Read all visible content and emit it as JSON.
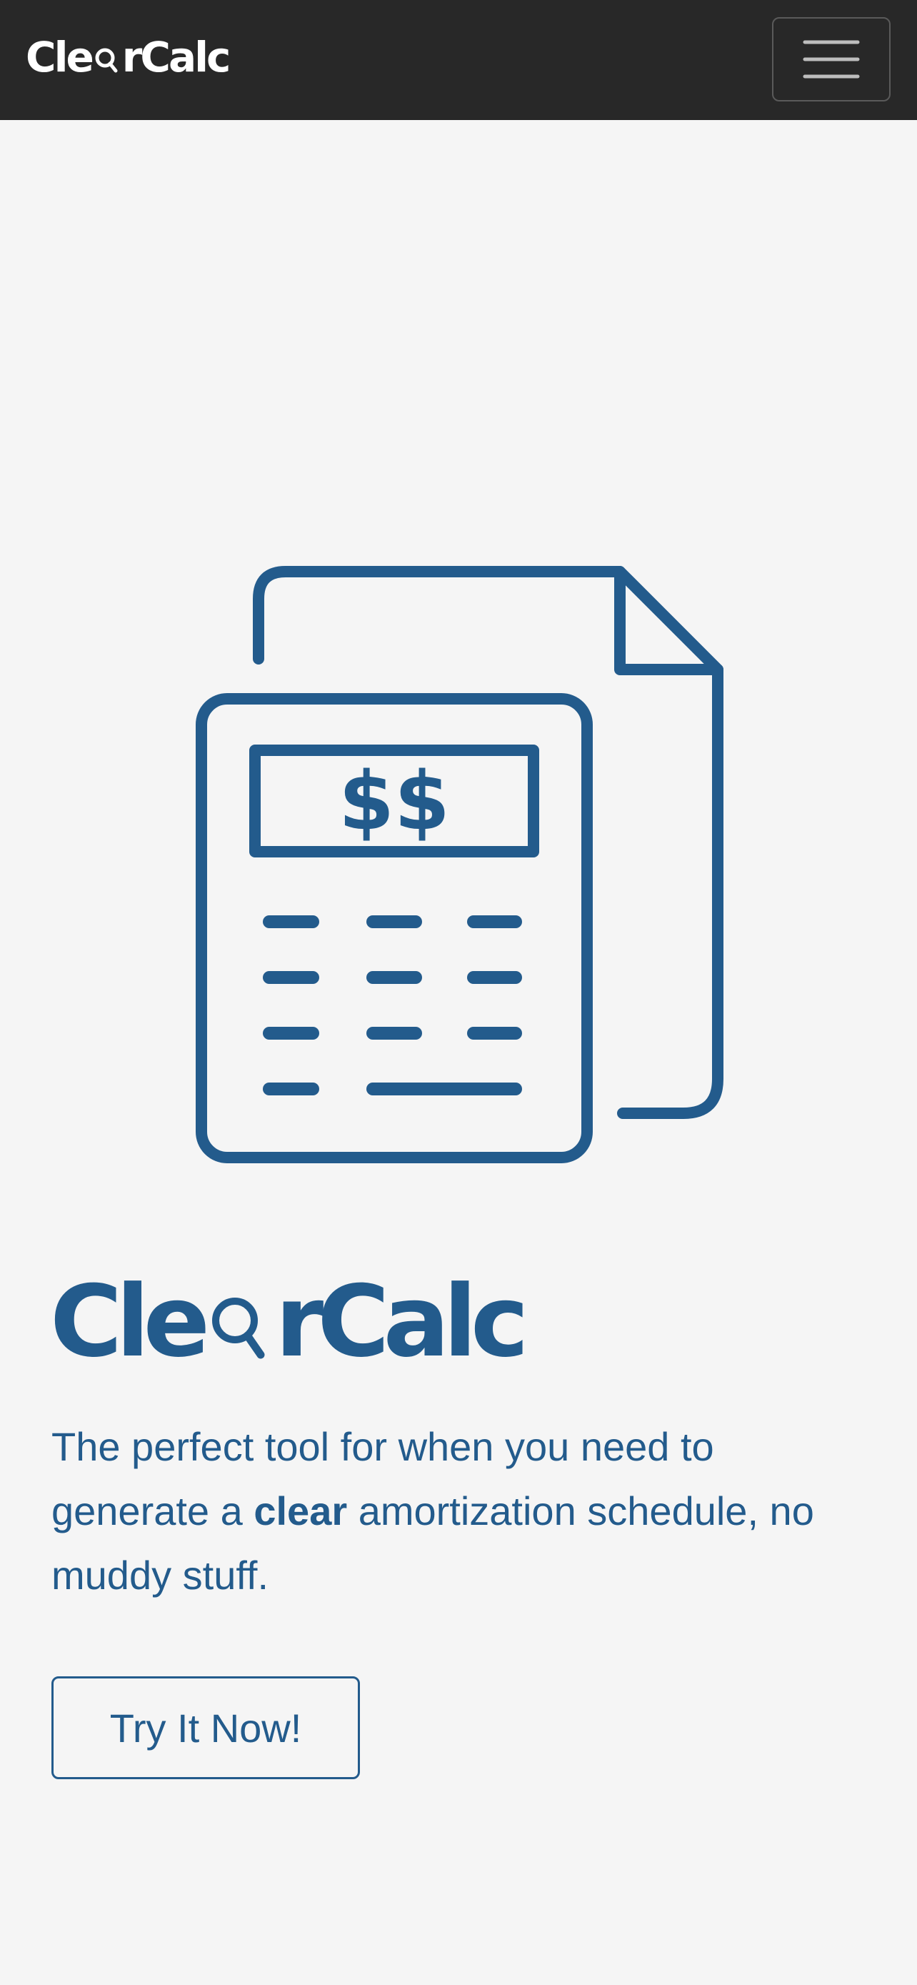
{
  "brand": {
    "name_prefix": "Cle",
    "name_suffix": "rCalc",
    "primary_color": "#235b8c",
    "nav_background": "#282828",
    "page_background": "#f5f5f5"
  },
  "navbar": {
    "menu_icon": "hamburger-menu-icon"
  },
  "hero": {
    "illustration_icon": "calculator-document-icon",
    "screen_text": "$$",
    "tagline_before": "The perfect tool for when you need to generate a ",
    "tagline_emphasis": "clear",
    "tagline_after": " amortization schedule, no muddy stuff.",
    "cta_label": "Try It Now!"
  }
}
